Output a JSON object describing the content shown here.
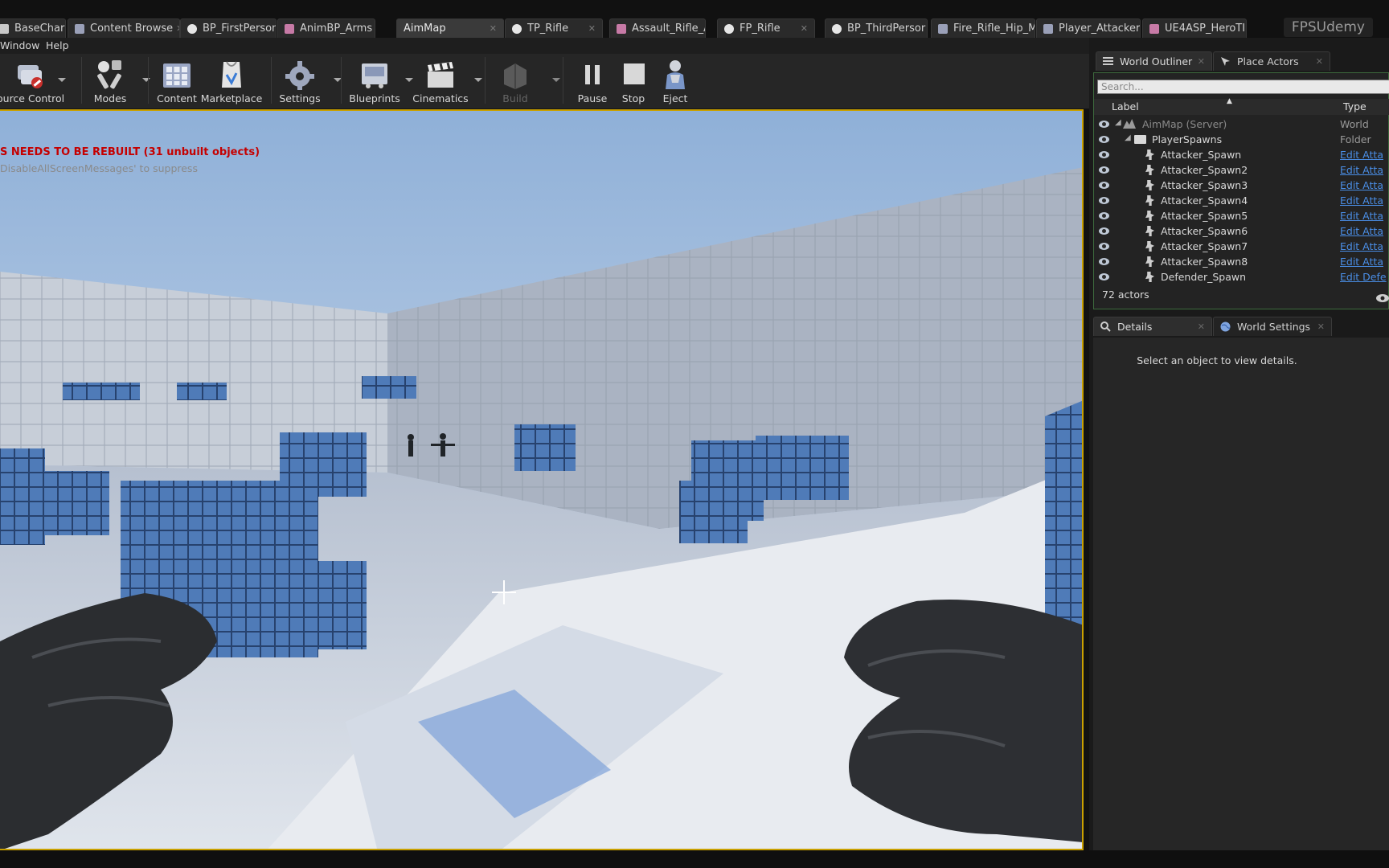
{
  "tabs": [
    {
      "label": "BaseCharac",
      "icon": "blueprint-icon"
    },
    {
      "label": "Content Browse",
      "icon": "content-browser-icon"
    },
    {
      "label": "BP_FirstPerson",
      "icon": "blueprint-circle-icon"
    },
    {
      "label": "AnimBP_Arms",
      "icon": "anim-blueprint-icon"
    },
    {
      "label": "AimMap",
      "icon": ""
    },
    {
      "label": "TP_Rifle",
      "icon": "blueprint-circle-icon"
    },
    {
      "label": "Assault_Rifle_A",
      "icon": "mesh-icon"
    },
    {
      "label": "FP_Rifle",
      "icon": "blueprint-circle-icon"
    },
    {
      "label": "BP_ThirdPersor",
      "icon": "blueprint-circle-icon"
    },
    {
      "label": "Fire_Rifle_Hip_M",
      "icon": "anim-sequence-icon"
    },
    {
      "label": "Player_Attacker",
      "icon": "character-icon"
    },
    {
      "label": "UE4ASP_HeroTI",
      "icon": "anim-blueprint-icon"
    }
  ],
  "brand": "FPSUdemy",
  "menu": [
    "Window",
    "Help"
  ],
  "toolbar": {
    "source_control": "ource Control",
    "modes": "Modes",
    "content": "Content",
    "marketplace": "Marketplace",
    "settings": "Settings",
    "blueprints": "Blueprints",
    "cinematics": "Cinematics",
    "build": "Build",
    "pause": "Pause",
    "stop": "Stop",
    "eject": "Eject"
  },
  "viewport": {
    "warning": "S NEEDS TO BE REBUILT (31 unbuilt objects)",
    "hint": "DisableAllScreenMessages' to suppress"
  },
  "outliner": {
    "tab_label": "World Outliner",
    "place_tab_label": "Place Actors",
    "search_placeholder": "Search...",
    "col_label": "Label",
    "col_type": "Type",
    "rows": [
      {
        "label": "AimMap (Server)",
        "type": "World",
        "indent": 0
      },
      {
        "label": "PlayerSpawns",
        "type": "Folder",
        "indent": 1
      },
      {
        "label": "Attacker_Spawn",
        "type": "Edit Atta",
        "indent": 2
      },
      {
        "label": "Attacker_Spawn2",
        "type": "Edit Atta",
        "indent": 2
      },
      {
        "label": "Attacker_Spawn3",
        "type": "Edit Atta",
        "indent": 2
      },
      {
        "label": "Attacker_Spawn4",
        "type": "Edit Atta",
        "indent": 2
      },
      {
        "label": "Attacker_Spawn5",
        "type": "Edit Atta",
        "indent": 2
      },
      {
        "label": "Attacker_Spawn6",
        "type": "Edit Atta",
        "indent": 2
      },
      {
        "label": "Attacker_Spawn7",
        "type": "Edit Atta",
        "indent": 2
      },
      {
        "label": "Attacker_Spawn8",
        "type": "Edit Atta",
        "indent": 2
      },
      {
        "label": "Defender_Spawn",
        "type": "Edit Defe",
        "indent": 2
      }
    ],
    "actor_count": "72 actors"
  },
  "details": {
    "tab_label": "Details",
    "world_settings_label": "World Settings",
    "empty_message": "Select an object to view details."
  },
  "colors": {
    "accent_yellow": "#c9a000",
    "warning_red": "#c50000",
    "link_blue": "#4a8ee6",
    "outliner_border": "#3d6a3d"
  }
}
